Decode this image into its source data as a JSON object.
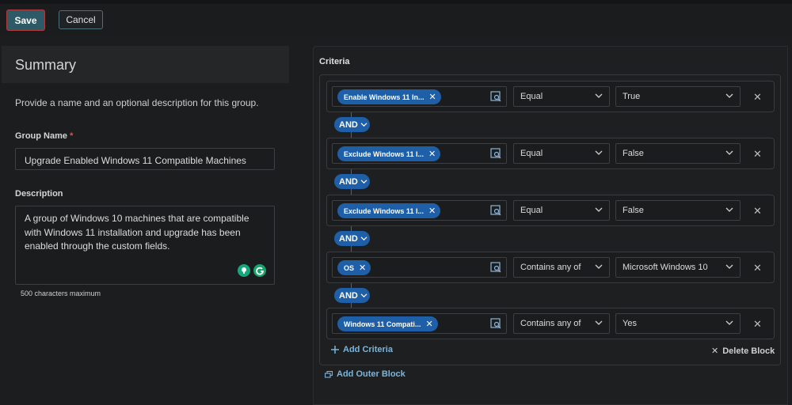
{
  "toolbar": {
    "save_label": "Save",
    "cancel_label": "Cancel"
  },
  "summary": {
    "title": "Summary",
    "description": "Provide a name and an optional description for this group.",
    "group_name_label": "Group Name",
    "required_mark": "*",
    "group_name_value": "Upgrade Enabled Windows 11 Compatible Machines",
    "description_label": "Description",
    "description_lines": [
      "A group of Windows 10 machines that are compatible",
      "with Windows 11 installation and upgrade has been",
      "enabled through the custom fields."
    ],
    "char_limit": "500 characters maximum"
  },
  "criteria": {
    "title": "Criteria",
    "connector_label": "AND",
    "rows": [
      {
        "field": "Enable Windows 11 In...",
        "operator": "Equal",
        "value": "True"
      },
      {
        "field": "Exclude Windows 11 I...",
        "operator": "Equal",
        "value": "False"
      },
      {
        "field": "Exclude Windows 11 I...",
        "operator": "Equal",
        "value": "False"
      },
      {
        "field": "OS",
        "operator": "Contains any of",
        "value": "Microsoft Windows 10"
      },
      {
        "field": "Windows 11 Compati...",
        "operator": "Contains any of",
        "value": "Yes"
      }
    ],
    "add_criteria_label": "Add Criteria",
    "delete_block_label": "Delete Block",
    "add_outer_block_label": "Add Outer Block"
  },
  "colors": {
    "accent": "#1e5fa8",
    "link": "#7db5da",
    "save_button": "#2e5a68",
    "required": "#e0524f"
  },
  "icons": [
    "close-icon",
    "lookup-icon",
    "chevron-down-icon",
    "plus-icon",
    "outer-block-icon",
    "grammarly-icon"
  ]
}
